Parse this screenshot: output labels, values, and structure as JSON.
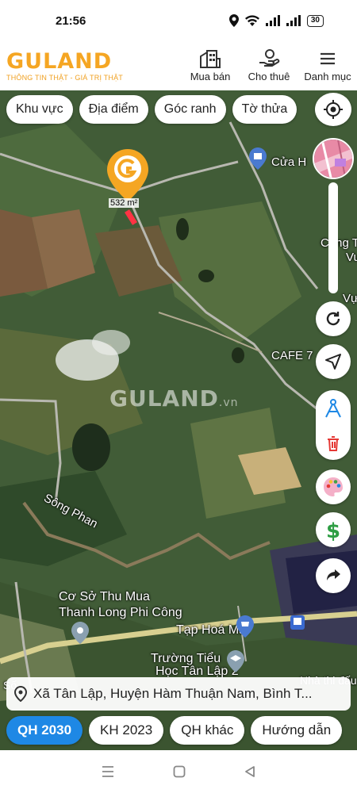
{
  "status": {
    "time": "21:56",
    "battery": "30"
  },
  "header": {
    "logo_text": "GULAND",
    "logo_tagline": "THÔNG TIN THẬT - GIÁ TRỊ THẬT",
    "nav": [
      {
        "label": "Mua bán",
        "icon": "building-icon"
      },
      {
        "label": "Cho thuê",
        "icon": "hand-icon"
      },
      {
        "label": "Danh mục",
        "icon": "menu-icon"
      }
    ]
  },
  "chips": [
    "Khu vực",
    "Địa điểm",
    "Góc ranh",
    "Tờ thửa"
  ],
  "map": {
    "watermark": "GULAND",
    "watermark_suffix": ".vn",
    "area": "532 m²",
    "labels": [
      "Cửa H",
      "Công T",
      "Vu",
      "Vự",
      "CAFE 7",
      "Sông Phan",
      "Cơ Sở Thu Mua",
      "Thanh Long Phi Công",
      "Tạp Hoá Mai",
      "Trường Tiểu",
      "Học Tân Lập 2",
      "Nhà thi đấu x",
      "Số"
    ]
  },
  "address": "Xã Tân Lập, Huyện Hàm Thuận Nam, Bình T...",
  "bottom_tabs": [
    "QH 2030",
    "KH 2023",
    "QH khác",
    "Hướng dẫn"
  ],
  "colors": {
    "accent": "#f5a623",
    "active_tab": "#1e88e5"
  }
}
